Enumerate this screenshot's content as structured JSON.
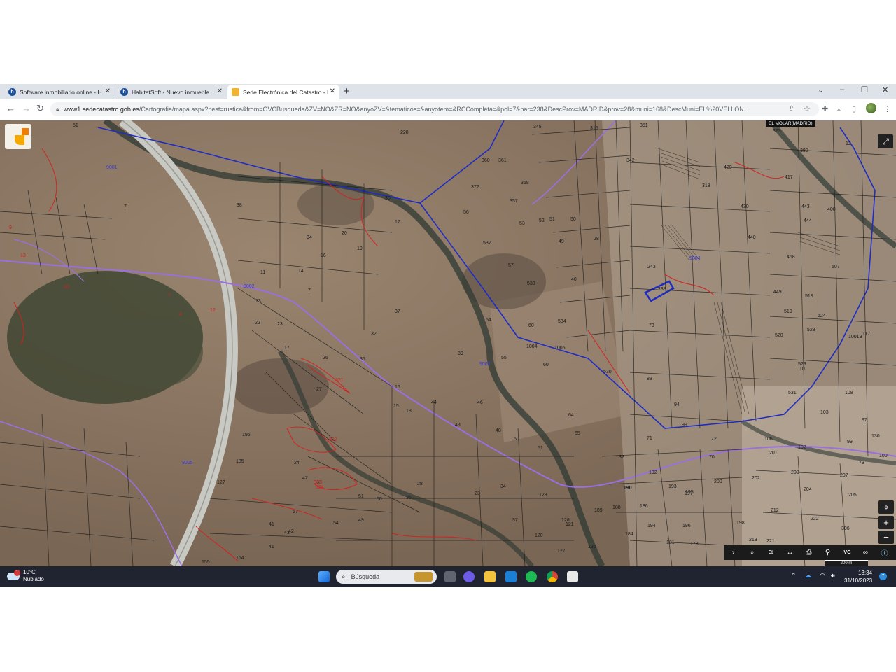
{
  "browser": {
    "tabs": [
      {
        "title": "Software inmobiliario online - H",
        "favicon": "habitatsoft-icon"
      },
      {
        "title": "HabitatSoft - Nuevo inmueble",
        "favicon": "habitatsoft-icon"
      },
      {
        "title": "Sede Electrónica del Catastro - I",
        "favicon": "catastro-icon",
        "active": true
      }
    ],
    "url_host": "www1.sedecatastro.gob.es",
    "url_path": "/Cartografia/mapa.aspx?pest=rustica&from=OVCBusqueda&ZV=NO&ZR=NO&anyoZV=&tematicos=&anyotem=&RCCompleta=&pol=7&par=238&DescProv=MADRID&prov=28&muni=168&DescMuni=EL%20VELLON..."
  },
  "map": {
    "region_label": "EL MOLAR(MADRID)",
    "scale_label": "200 m",
    "toolbar_icons": [
      "chevron-right-icon",
      "search-icon",
      "layers-icon",
      "measure-icon",
      "print-icon",
      "location-icon",
      "ivg-icon",
      "binoculars-icon",
      "info-icon"
    ],
    "ivg_label": "IVG",
    "highlighted_parcel": "238",
    "plot_labels": [
      {
        "t": "51",
        "c": "k"
      },
      {
        "t": "228",
        "c": "k"
      },
      {
        "t": "345",
        "c": "k"
      },
      {
        "t": "315",
        "c": "k"
      },
      {
        "t": "351",
        "c": "k"
      },
      {
        "t": "373",
        "c": "k"
      },
      {
        "t": "380",
        "c": "k"
      },
      {
        "t": "12",
        "c": "k"
      },
      {
        "t": "360",
        "c": "k"
      },
      {
        "t": "361",
        "c": "k"
      },
      {
        "t": "342",
        "c": "k"
      },
      {
        "t": "429",
        "c": "k"
      },
      {
        "t": "372",
        "c": "k"
      },
      {
        "t": "358",
        "c": "k"
      },
      {
        "t": "318",
        "c": "k"
      },
      {
        "t": "417",
        "c": "k"
      },
      {
        "t": "30",
        "c": "k"
      },
      {
        "t": "17",
        "c": "k"
      },
      {
        "t": "56",
        "c": "k"
      },
      {
        "t": "357",
        "c": "k"
      },
      {
        "t": "53",
        "c": "k"
      },
      {
        "t": "52",
        "c": "k"
      },
      {
        "t": "51",
        "c": "k"
      },
      {
        "t": "50",
        "c": "k"
      },
      {
        "t": "430",
        "c": "k"
      },
      {
        "t": "443",
        "c": "k"
      },
      {
        "t": "400",
        "c": "k"
      },
      {
        "t": "38",
        "c": "k"
      },
      {
        "t": "7",
        "c": "k"
      },
      {
        "t": "34",
        "c": "k"
      },
      {
        "t": "20",
        "c": "k"
      },
      {
        "t": "532",
        "c": "k"
      },
      {
        "t": "28",
        "c": "k"
      },
      {
        "t": "49",
        "c": "k"
      },
      {
        "t": "440",
        "c": "k"
      },
      {
        "t": "444",
        "c": "k"
      },
      {
        "t": "11",
        "c": "k"
      },
      {
        "t": "14",
        "c": "k"
      },
      {
        "t": "16",
        "c": "k"
      },
      {
        "t": "19",
        "c": "k"
      },
      {
        "t": "57",
        "c": "k"
      },
      {
        "t": "243",
        "c": "k"
      },
      {
        "t": "458",
        "c": "k"
      },
      {
        "t": "507",
        "c": "k"
      },
      {
        "t": "7",
        "c": "k"
      },
      {
        "t": "13",
        "c": "k"
      },
      {
        "t": "533",
        "c": "k"
      },
      {
        "t": "40",
        "c": "k"
      },
      {
        "t": "238",
        "c": "k"
      },
      {
        "t": "449",
        "c": "k"
      },
      {
        "t": "518",
        "c": "k"
      },
      {
        "t": "22",
        "c": "k"
      },
      {
        "t": "23",
        "c": "k"
      },
      {
        "t": "37",
        "c": "k"
      },
      {
        "t": "54",
        "c": "k"
      },
      {
        "t": "534",
        "c": "k"
      },
      {
        "t": "60",
        "c": "k"
      },
      {
        "t": "73",
        "c": "k"
      },
      {
        "t": "519",
        "c": "k"
      },
      {
        "t": "524",
        "c": "k"
      },
      {
        "t": "17",
        "c": "k"
      },
      {
        "t": "32",
        "c": "k"
      },
      {
        "t": "1004",
        "c": "k"
      },
      {
        "t": "1005",
        "c": "k"
      },
      {
        "t": "520",
        "c": "k"
      },
      {
        "t": "523",
        "c": "k"
      },
      {
        "t": "10019",
        "c": "k"
      },
      {
        "t": "117",
        "c": "k"
      },
      {
        "t": "26",
        "c": "k"
      },
      {
        "t": "35",
        "c": "k"
      },
      {
        "t": "39",
        "c": "k"
      },
      {
        "t": "55",
        "c": "k"
      },
      {
        "t": "60",
        "c": "k"
      },
      {
        "t": "530",
        "c": "k"
      },
      {
        "t": "529",
        "c": "k"
      },
      {
        "t": "10",
        "c": "k"
      },
      {
        "t": "16",
        "c": "k"
      },
      {
        "t": "27",
        "c": "k"
      },
      {
        "t": "44",
        "c": "k"
      },
      {
        "t": "46",
        "c": "k"
      },
      {
        "t": "88",
        "c": "k"
      },
      {
        "t": "531",
        "c": "k"
      },
      {
        "t": "108",
        "c": "k"
      },
      {
        "t": "15",
        "c": "k"
      },
      {
        "t": "18",
        "c": "k"
      },
      {
        "t": "43",
        "c": "k"
      },
      {
        "t": "48",
        "c": "k"
      },
      {
        "t": "64",
        "c": "k"
      },
      {
        "t": "94",
        "c": "k"
      },
      {
        "t": "99",
        "c": "k"
      },
      {
        "t": "103",
        "c": "k"
      },
      {
        "t": "97",
        "c": "k"
      },
      {
        "t": "195",
        "c": "k"
      },
      {
        "t": "50",
        "c": "k"
      },
      {
        "t": "51",
        "c": "k"
      },
      {
        "t": "65",
        "c": "k"
      },
      {
        "t": "71",
        "c": "k"
      },
      {
        "t": "72",
        "c": "k"
      },
      {
        "t": "106",
        "c": "k"
      },
      {
        "t": "102",
        "c": "k"
      },
      {
        "t": "99",
        "c": "k"
      },
      {
        "t": "130",
        "c": "k"
      },
      {
        "t": "185",
        "c": "k"
      },
      {
        "t": "24",
        "c": "k"
      },
      {
        "t": "32",
        "c": "k"
      },
      {
        "t": "70",
        "c": "k"
      },
      {
        "t": "201",
        "c": "k"
      },
      {
        "t": "73",
        "c": "k"
      },
      {
        "t": "100",
        "c": "k"
      },
      {
        "t": "127",
        "c": "k"
      },
      {
        "t": "47",
        "c": "k"
      },
      {
        "t": "33",
        "c": "k"
      },
      {
        "t": "28",
        "c": "k"
      },
      {
        "t": "23",
        "c": "k"
      },
      {
        "t": "34",
        "c": "k"
      },
      {
        "t": "191",
        "c": "k"
      },
      {
        "t": "192",
        "c": "k"
      },
      {
        "t": "200",
        "c": "k"
      },
      {
        "t": "202",
        "c": "k"
      },
      {
        "t": "203",
        "c": "k"
      },
      {
        "t": "207",
        "c": "k"
      },
      {
        "t": "51",
        "c": "k"
      },
      {
        "t": "50",
        "c": "k"
      },
      {
        "t": "36",
        "c": "k"
      },
      {
        "t": "123",
        "c": "k"
      },
      {
        "t": "190",
        "c": "k"
      },
      {
        "t": "193",
        "c": "k"
      },
      {
        "t": "195",
        "c": "k"
      },
      {
        "t": "204",
        "c": "k"
      },
      {
        "t": "205",
        "c": "k"
      },
      {
        "t": "57",
        "c": "k"
      },
      {
        "t": "54",
        "c": "k"
      },
      {
        "t": "49",
        "c": "k"
      },
      {
        "t": "37",
        "c": "k"
      },
      {
        "t": "121",
        "c": "k"
      },
      {
        "t": "189",
        "c": "k"
      },
      {
        "t": "186",
        "c": "k"
      },
      {
        "t": "197",
        "c": "k"
      },
      {
        "t": "212",
        "c": "k"
      },
      {
        "t": "222",
        "c": "k"
      },
      {
        "t": "41",
        "c": "k"
      },
      {
        "t": "42",
        "c": "k"
      },
      {
        "t": "43",
        "c": "k"
      },
      {
        "t": "120",
        "c": "k"
      },
      {
        "t": "126",
        "c": "k"
      },
      {
        "t": "188",
        "c": "k"
      },
      {
        "t": "194",
        "c": "k"
      },
      {
        "t": "196",
        "c": "k"
      },
      {
        "t": "198",
        "c": "k"
      },
      {
        "t": "306",
        "c": "k"
      },
      {
        "t": "155",
        "c": "k"
      },
      {
        "t": "164",
        "c": "k"
      },
      {
        "t": "41",
        "c": "k"
      },
      {
        "t": "127",
        "c": "k"
      },
      {
        "t": "136",
        "c": "k"
      },
      {
        "t": "184",
        "c": "k"
      },
      {
        "t": "181",
        "c": "k"
      },
      {
        "t": "178",
        "c": "k"
      },
      {
        "t": "213",
        "c": "k"
      },
      {
        "t": "221",
        "c": "k"
      },
      {
        "t": "9",
        "c": "r"
      },
      {
        "t": "13",
        "c": "r"
      },
      {
        "t": "10",
        "c": "r"
      },
      {
        "t": "7",
        "c": "r"
      },
      {
        "t": "4",
        "c": "r"
      },
      {
        "t": "12",
        "c": "r"
      },
      {
        "t": "321",
        "c": "r"
      },
      {
        "t": "322",
        "c": "r"
      },
      {
        "t": "323",
        "c": "r"
      },
      {
        "t": "324",
        "c": "r"
      },
      {
        "t": "9001",
        "c": "b"
      },
      {
        "t": "9002",
        "c": "b"
      },
      {
        "t": "9003",
        "c": "b"
      },
      {
        "t": "9004",
        "c": "b"
      },
      {
        "t": "9005",
        "c": "b"
      }
    ]
  },
  "taskbar": {
    "weather_temp": "10°C",
    "weather_desc": "Nublado",
    "weather_badge": "1",
    "search_placeholder": "Búsqueda",
    "time": "13:34",
    "date": "31/10/2023",
    "notif_count": "7"
  }
}
